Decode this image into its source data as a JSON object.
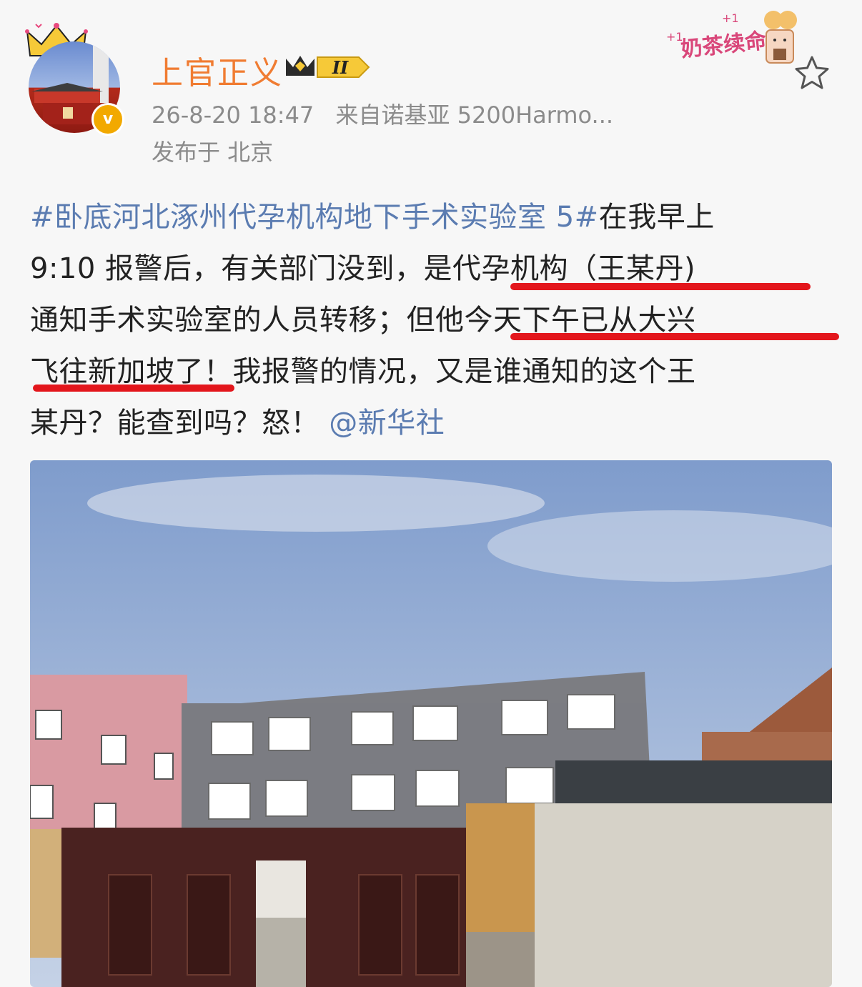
{
  "user": {
    "name": "上官正义",
    "level": "II",
    "verified_mark": "v"
  },
  "post_meta": {
    "datetime": "26-8-20 18:47",
    "source": "来自诺基亚 5200Harmo...",
    "location": "发布于 北京"
  },
  "sticker": {
    "text": "奶茶续命",
    "plus": "+1"
  },
  "post": {
    "line1_hashtag": "#卧底河北涿州代孕机构地下手术实验室 5#",
    "line1_rest": "在我早上",
    "line2": "9:10 报警后，有关部门没到，是代孕机构（王某丹)",
    "line3": "通知手术实验室的人员转移；但他今天下午已从大兴",
    "line4": "飞往新加坡了！我报警的情况，又是谁通知的这个王",
    "line5_text": "某丹？能查到吗？怒！",
    "line5_mention": "@新华社"
  },
  "colors": {
    "username": "#f07c32",
    "link": "#5b7cb1",
    "underline": "#e3161c",
    "meta": "#8b8b8b"
  },
  "icons": [
    "crown-icon",
    "verified-icon",
    "level-crown-icon",
    "favorite-star-icon"
  ]
}
